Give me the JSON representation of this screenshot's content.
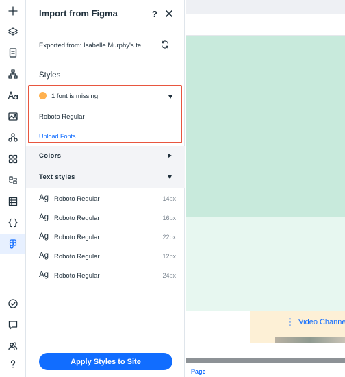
{
  "rail": {
    "items": [
      {
        "name": "add-icon"
      },
      {
        "name": "layers-icon"
      },
      {
        "name": "pages-icon"
      },
      {
        "name": "sitemap-icon"
      },
      {
        "name": "fonts-icon"
      },
      {
        "name": "media-icon"
      },
      {
        "name": "apps-hub-icon"
      },
      {
        "name": "app-market-icon"
      },
      {
        "name": "business-apps-icon"
      },
      {
        "name": "cms-table-icon"
      },
      {
        "name": "code-braces-icon"
      },
      {
        "name": "figma-icon",
        "active": true
      },
      {
        "name": "checklist-icon"
      },
      {
        "name": "chat-icon"
      },
      {
        "name": "community-icon"
      },
      {
        "name": "help-icon"
      }
    ]
  },
  "panel": {
    "title": "Import from Figma",
    "help_label": "?",
    "exported_from": "Exported from: Isabelle Murphy's te...",
    "styles_heading": "Styles",
    "missing": {
      "text": "1 font is missing",
      "font": "Roboto Regular",
      "upload_label": "Upload Fonts"
    },
    "colors_label": "Colors",
    "text_styles_label": "Text styles",
    "text_styles": [
      {
        "ag": "Ag",
        "name": "Roboto Regular",
        "size": "14px"
      },
      {
        "ag": "Ag",
        "name": "Roboto Regular",
        "size": "16px"
      },
      {
        "ag": "Ag",
        "name": "Roboto Regular",
        "size": "22px"
      },
      {
        "ag": "Ag",
        "name": "Roboto Regular",
        "size": "12px"
      },
      {
        "ag": "Ag",
        "name": "Roboto Regular",
        "size": "24px"
      }
    ],
    "apply_label": "Apply Styles to Site"
  },
  "canvas": {
    "video_label": "Video Channe",
    "page_label": "Page"
  },
  "colors": {
    "accent": "#116dff",
    "highlight_border": "#e8563f",
    "warning": "#ffb14f",
    "canvas_green": "#c8eadc",
    "canvas_light_green": "#e7f7f0",
    "video_bg": "#fdf0d6"
  }
}
